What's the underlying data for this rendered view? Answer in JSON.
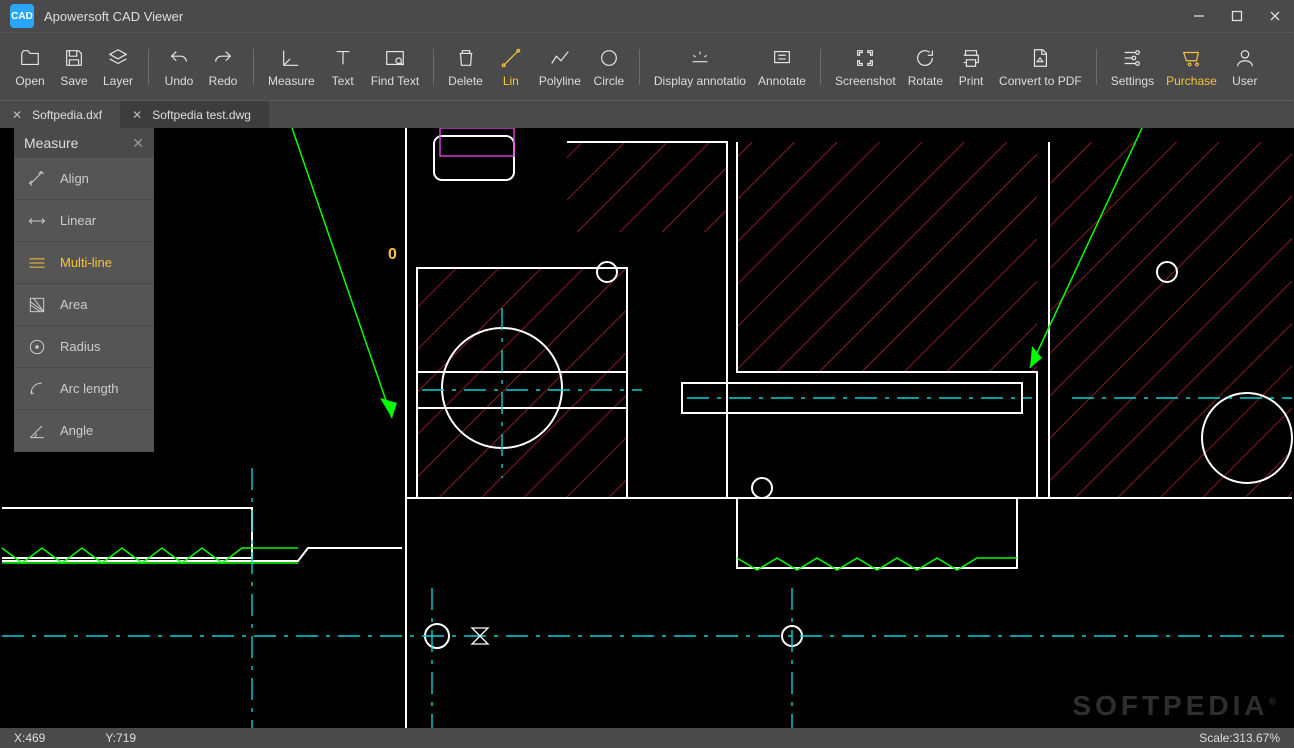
{
  "window": {
    "title": "Apowersoft CAD Viewer"
  },
  "toolbar": {
    "open": "Open",
    "save": "Save",
    "layer": "Layer",
    "undo": "Undo",
    "redo": "Redo",
    "measure": "Measure",
    "text": "Text",
    "findtext": "Find Text",
    "delete": "Delete",
    "lin": "Lin",
    "polyline": "Polyline",
    "circle": "Circle",
    "display_anno": "Display annotatio",
    "annotate": "Annotate",
    "screenshot": "Screenshot",
    "rotate": "Rotate",
    "print": "Print",
    "pdf": "Convert to PDF",
    "settings": "Settings",
    "purchase": "Purchase",
    "user": "User"
  },
  "tabs": [
    {
      "label": "Softpedia.dxf",
      "active": false
    },
    {
      "label": "Softpedia test.dwg",
      "active": true
    }
  ],
  "measure_panel": {
    "title": "Measure",
    "options": [
      {
        "id": "align",
        "label": "Align"
      },
      {
        "id": "linear",
        "label": "Linear"
      },
      {
        "id": "multiline",
        "label": "Multi-line",
        "selected": true
      },
      {
        "id": "area",
        "label": "Area"
      },
      {
        "id": "radius",
        "label": "Radius"
      },
      {
        "id": "arclength",
        "label": "Arc length"
      },
      {
        "id": "angle",
        "label": "Angle"
      }
    ]
  },
  "annotations": {
    "zero_label": "0"
  },
  "status": {
    "x_label": "X:469",
    "y_label": "Y:719",
    "scale_label": "Scale:313.67%"
  },
  "watermark": "SOFTPEDIA"
}
